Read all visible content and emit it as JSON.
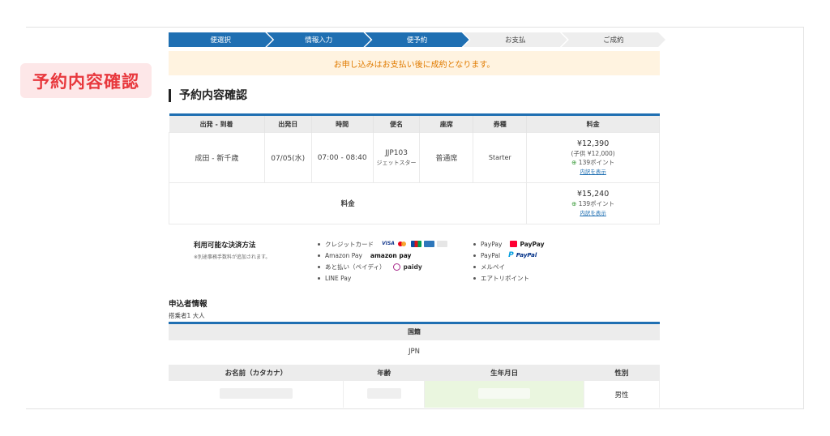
{
  "badge": {
    "label": "予約内容確認"
  },
  "steps": [
    {
      "label": "便選択",
      "state": "done"
    },
    {
      "label": "情報入力",
      "state": "done"
    },
    {
      "label": "便予約",
      "state": "done"
    },
    {
      "label": "お支払",
      "state": "todo"
    },
    {
      "label": "ご成約",
      "state": "todo"
    }
  ],
  "notice": "お申し込みはお支払い後に成約となります。",
  "section_title": "予約内容確認",
  "booking_table": {
    "headers": [
      "出発 - 到着",
      "出発日",
      "時間",
      "便名",
      "座席",
      "券種",
      "料金"
    ],
    "row": {
      "route": "成田 - 新千歳",
      "date": "07/05(水)",
      "time": "07:00 - 08:40",
      "flight_no": "JJP103",
      "flight_brand": "ジェットスター",
      "seat": "普通席",
      "fare_type": "Starter",
      "price": "¥12,390",
      "child_price": "(子供 ¥12,000)",
      "points": "139ポイント",
      "detail_link": "内訳を表示"
    },
    "total": {
      "label": "料金",
      "price": "¥15,240",
      "points": "139ポイント",
      "detail_link": "内訳を表示"
    }
  },
  "payment": {
    "title": "利用可能な決済方法",
    "note": "※別途事務手数料が追加されます。",
    "col1": [
      "クレジットカード",
      "Amazon Pay",
      "あと払い（ペイディ）",
      "LINE Pay"
    ],
    "col2": [
      "PayPay",
      "PayPal",
      "メルペイ",
      "エアトリポイント"
    ],
    "logos": {
      "visa": "VISA",
      "amazon": "amazon pay",
      "paidy": "paidy",
      "paypay": "PayPay",
      "paypal": "PayPal"
    }
  },
  "applicant": {
    "title": "申込者情報",
    "passenger": "搭乗者1 大人",
    "nationality_header": "国籍",
    "nationality": "JPN",
    "name_headers": [
      "お名前（カタカナ）",
      "年齢",
      "生年月日",
      "性別"
    ],
    "gender": "男性"
  },
  "colors": {
    "primary": "#1f6fb2",
    "accent": "#e8383d",
    "notice_bg": "#fff3e0",
    "notice_text": "#e07b00"
  }
}
